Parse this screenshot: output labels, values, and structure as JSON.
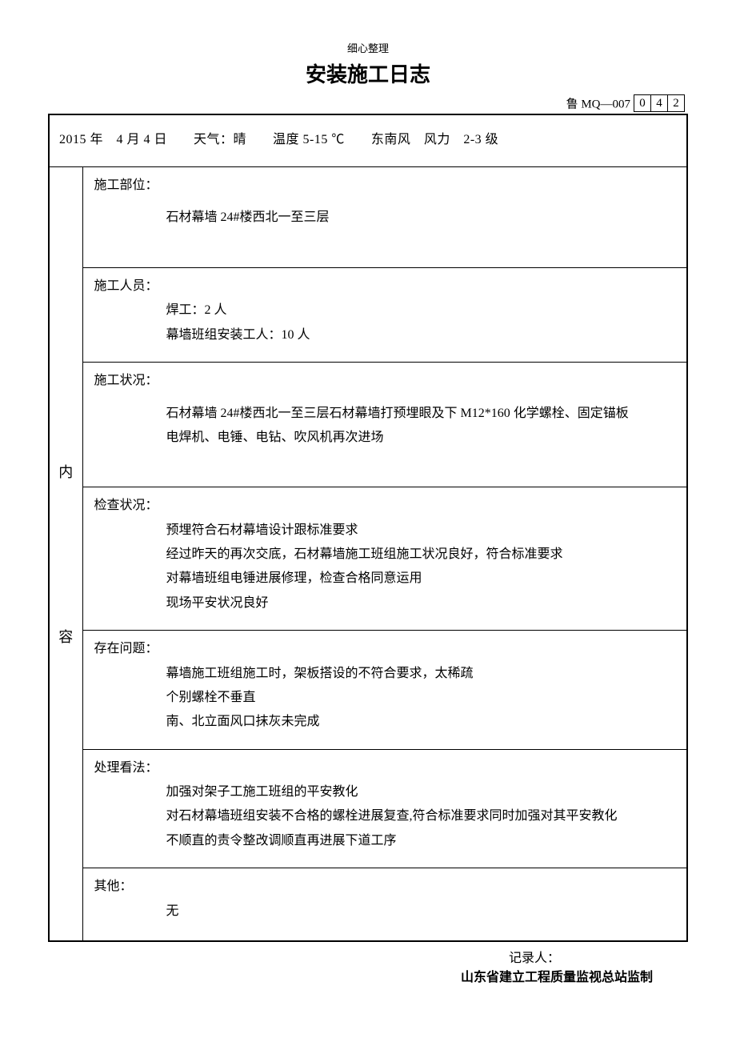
{
  "header_note": "细心整理",
  "title": "安装施工日志",
  "doc_code_label": "鲁 MQ—007",
  "doc_code_boxes": [
    "0",
    "4",
    "2"
  ],
  "date_line": "2015 年　4 月 4 日　　天气：晴　　温度 5-15 ℃　　东南风　风力　2-3 级",
  "side_top": "内",
  "side_bottom": "容",
  "sections": {
    "location": {
      "label": "施工部位：",
      "body": "石材幕墙 24#楼西北一至三层"
    },
    "personnel": {
      "label": "施工人员：",
      "line1": "焊工：2 人",
      "line2": "幕墙班组安装工人：10 人"
    },
    "status": {
      "label": "施工状况：",
      "line1": "石材幕墙 24#楼西北一至三层石材幕墙打预埋眼及下 M12*160 化学螺栓、固定锚板",
      "line2": "电焊机、电锤、电钻、吹风机再次进场"
    },
    "inspection": {
      "label": "检查状况：",
      "line1": "预埋符合石材幕墙设计跟标准要求",
      "line2": "经过昨天的再次交底，石材幕墙施工班组施工状况良好，符合标准要求",
      "line3": "对幕墙班组电锤进展修理，检查合格同意运用",
      "line4": "现场平安状况良好"
    },
    "problems": {
      "label": "存在问题：",
      "line1": "幕墙施工班组施工时，架板搭设的不符合要求，太稀疏",
      "line2": "个别螺栓不垂直",
      "line3": "南、北立面风口抹灰未完成"
    },
    "handling": {
      "label": "处理看法：",
      "line1": "加强对架子工施工班组的平安教化",
      "line2": "对石材幕墙班组安装不合格的螺栓进展复查,符合标准要求同时加强对其平安教化",
      "line3": "不顺直的责令整改调顺直再进展下道工序"
    },
    "other": {
      "label": "其他：",
      "body": "无"
    }
  },
  "recorder_label": "记录人：",
  "footer_org": "山东省建立工程质量监视总站监制"
}
